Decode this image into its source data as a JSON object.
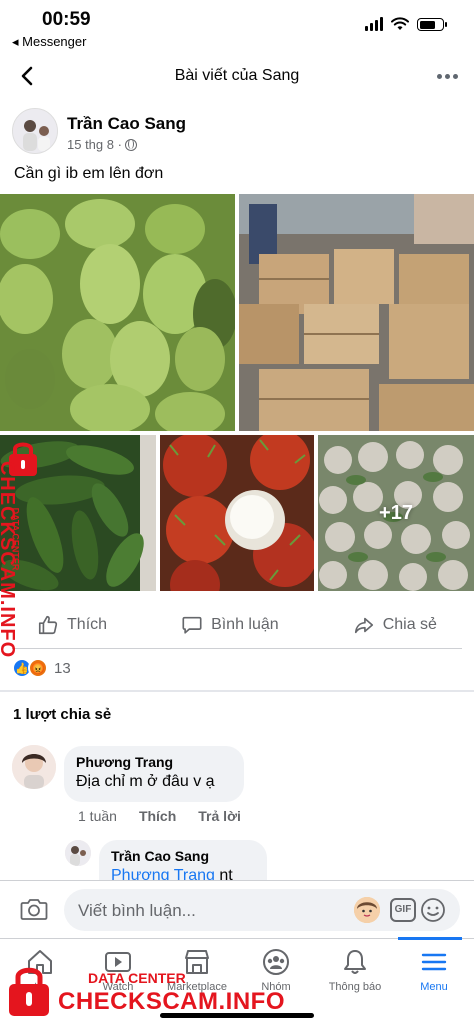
{
  "status_bar": {
    "time": "00:59",
    "back_app": "◂ Messenger"
  },
  "header": {
    "title": "Bài viết của Sang"
  },
  "post": {
    "author": "Trần Cao Sang",
    "date": "15 thg 8 ·",
    "text": "Cần gì ib em lên đơn",
    "more_photos": "+17"
  },
  "actions": {
    "like": "Thích",
    "comment": "Bình luận",
    "share": "Chia sẻ"
  },
  "reactions": {
    "count": "13"
  },
  "shares": "1 lượt chia sẻ",
  "comments": [
    {
      "name": "Phương Trang",
      "text": "Địa chỉ m ở đâu v ạ",
      "time": "1 tuần",
      "like": "Thích",
      "reply": "Trả lời"
    },
    {
      "name": "Trần Cao Sang",
      "mention": "Phương Trang",
      "text": " nt"
    }
  ],
  "composer": {
    "placeholder": "Viết bình luận...",
    "gif": "GIF"
  },
  "tabbar": [
    {
      "label": "tin"
    },
    {
      "label": "Watch"
    },
    {
      "label": "Marketplace"
    },
    {
      "label": "Nhóm"
    },
    {
      "label": "Thông báo"
    },
    {
      "label": "Menu"
    }
  ],
  "watermark": {
    "brand": "CHECKSCAM.INFO",
    "sub": "DATA CENTER"
  },
  "colors": {
    "accent": "#1877f2",
    "watermark": "#e4151e"
  }
}
